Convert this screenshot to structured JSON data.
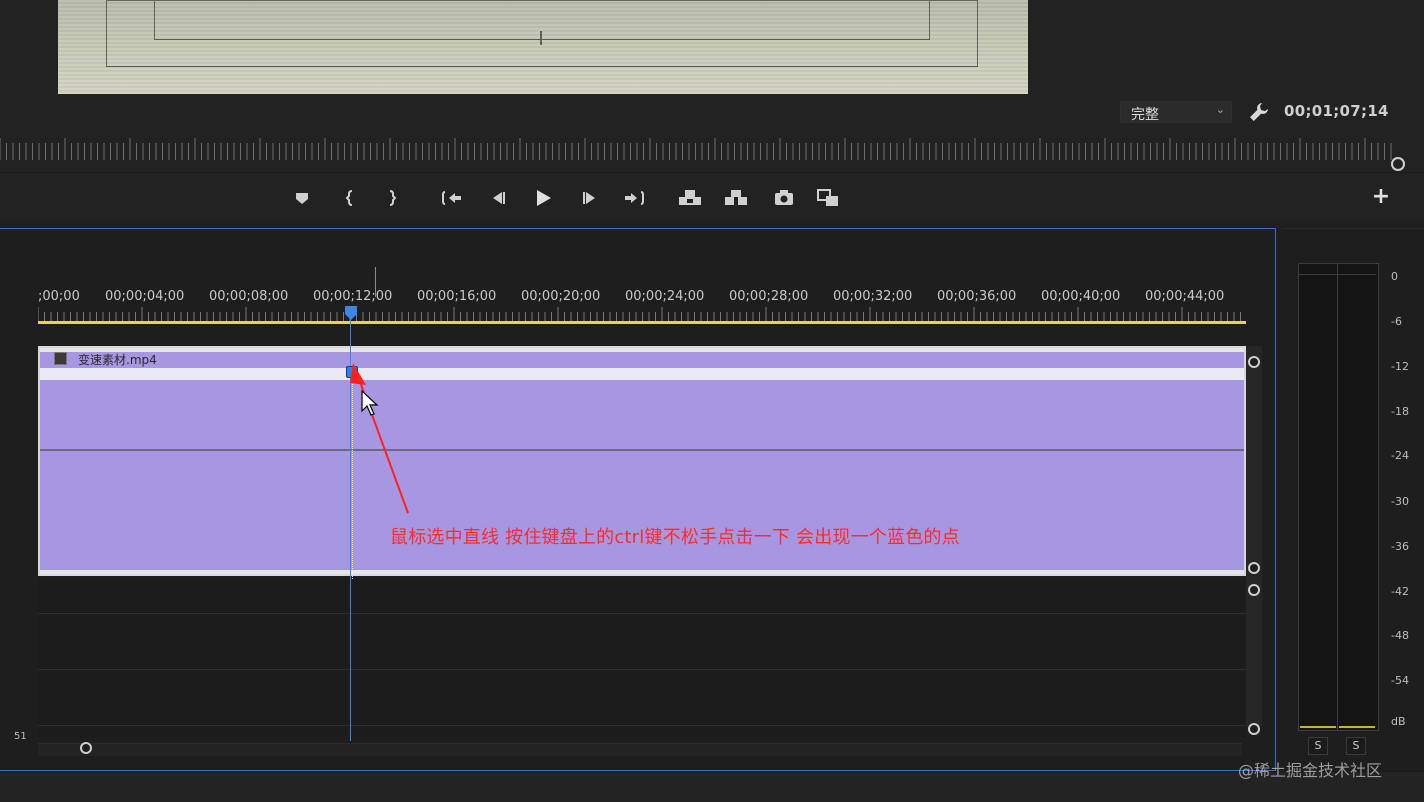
{
  "monitor": {
    "resolution": "完整",
    "timecode": "00;01;07;14"
  },
  "transport": {
    "add_label": "+"
  },
  "timeline": {
    "ruler_labels": [
      ";00;00",
      "00;00;04;00",
      "00;00;08;00",
      "00;00;12;00",
      "00;00;16;00",
      "00;00;20;00",
      "00;00;24;00",
      "00;00;28;00",
      "00;00;32;00",
      "00;00;36;00",
      "00;00;40;00",
      "00;00;44;00"
    ],
    "clip_name": "变速素材.mp4",
    "track_number": "51"
  },
  "annotation": "鼠标选中直线 按住键盘上的ctrl键不松手点击一下 会出现一个蓝色的点",
  "meters": {
    "db_labels": [
      "0",
      "-6",
      "-12",
      "-18",
      "-24",
      "-30",
      "-36",
      "-42",
      "-48",
      "-54",
      "dB"
    ],
    "solo_labels": [
      "S",
      "S"
    ]
  },
  "watermark": "@稀土掘金技术社区",
  "colors": {
    "clip": "#a797e2",
    "playhead": "#3e86e6",
    "annotation": "#ff2a2a",
    "work_area": "#e8d44d"
  }
}
